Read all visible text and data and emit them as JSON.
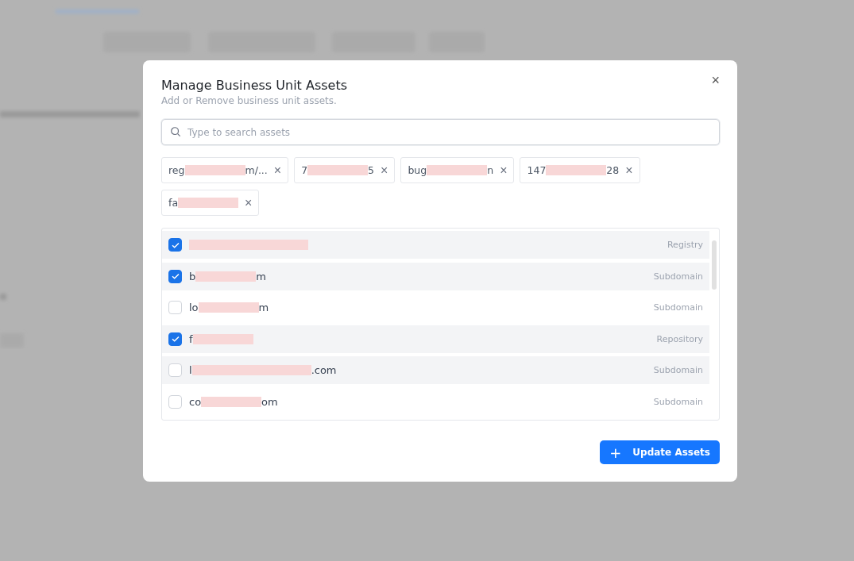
{
  "dialog": {
    "title": "Manage Business Unit Assets",
    "subtitle": "Add or Remove business unit assets.",
    "close": "×",
    "search": {
      "placeholder": "Type to search assets"
    },
    "chips": [
      {
        "segments": [
          {
            "kind": "text",
            "text": "reg"
          },
          {
            "kind": "redaction"
          },
          {
            "kind": "text",
            "text": "m/..."
          }
        ],
        "remove": "×"
      },
      {
        "segments": [
          {
            "kind": "text",
            "text": "7"
          },
          {
            "kind": "redaction"
          },
          {
            "kind": "text",
            "text": "5"
          }
        ],
        "remove": "×"
      },
      {
        "segments": [
          {
            "kind": "text",
            "text": "bug"
          },
          {
            "kind": "redaction"
          },
          {
            "kind": "text",
            "text": "n"
          }
        ],
        "remove": "×"
      },
      {
        "segments": [
          {
            "kind": "text",
            "text": "147"
          },
          {
            "kind": "redaction"
          },
          {
            "kind": "text",
            "text": "28"
          }
        ],
        "remove": "×"
      },
      {
        "segments": [
          {
            "kind": "text",
            "text": "fa"
          },
          {
            "kind": "redaction"
          }
        ],
        "remove": "×"
      }
    ],
    "assets": [
      {
        "checked": true,
        "highlighted": true,
        "segments": [
          {
            "kind": "redaction",
            "wide": true
          }
        ],
        "type": "Registry"
      },
      {
        "checked": true,
        "highlighted": true,
        "segments": [
          {
            "kind": "text",
            "text": "b"
          },
          {
            "kind": "redaction"
          },
          {
            "kind": "text",
            "text": "m"
          }
        ],
        "type": "Subdomain"
      },
      {
        "checked": false,
        "highlighted": false,
        "segments": [
          {
            "kind": "text",
            "text": "lo"
          },
          {
            "kind": "redaction"
          },
          {
            "kind": "text",
            "text": "m"
          }
        ],
        "type": "Subdomain"
      },
      {
        "checked": true,
        "highlighted": true,
        "segments": [
          {
            "kind": "text",
            "text": "f"
          },
          {
            "kind": "redaction"
          }
        ],
        "type": "Repository"
      },
      {
        "checked": false,
        "highlighted": true,
        "segments": [
          {
            "kind": "text",
            "text": "l"
          },
          {
            "kind": "redaction",
            "wide": true
          },
          {
            "kind": "text",
            "text": ".com"
          }
        ],
        "type": "Subdomain"
      },
      {
        "checked": false,
        "highlighted": false,
        "segments": [
          {
            "kind": "text",
            "text": "co"
          },
          {
            "kind": "redaction"
          },
          {
            "kind": "text",
            "text": "om"
          }
        ],
        "type": "Subdomain"
      }
    ],
    "button": {
      "icon": "+",
      "label": "Update Assets"
    }
  }
}
